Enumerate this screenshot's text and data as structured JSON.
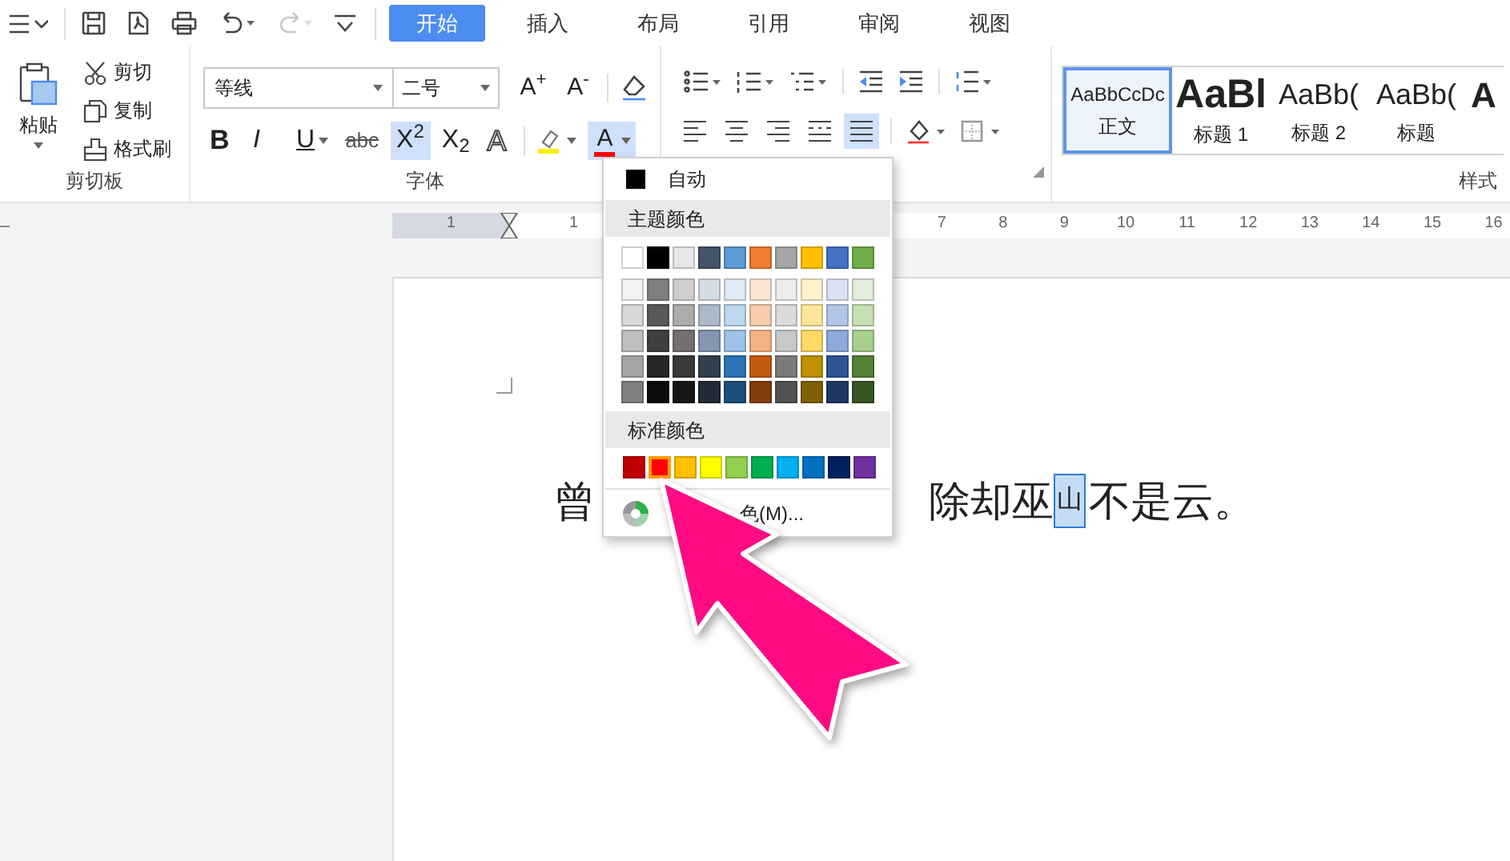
{
  "toolbar": {
    "redo": {
      "disabled": true
    },
    "tabs": [
      {
        "label": "开始",
        "selected": true
      },
      {
        "label": "插入",
        "selected": false
      },
      {
        "label": "布局",
        "selected": false
      },
      {
        "label": "引用",
        "selected": false
      },
      {
        "label": "审阅",
        "selected": false
      },
      {
        "label": "视图",
        "selected": false
      }
    ]
  },
  "ribbon": {
    "clipboard": {
      "paste": "粘贴",
      "items": [
        "剪切",
        "复制",
        "格式刷"
      ],
      "group_label": "剪切板"
    },
    "font": {
      "font_name": "等线",
      "font_size": "二号",
      "grow": "A$^{+}$",
      "shrink": "A$^{-}$",
      "format_buttons": [
        {
          "kind": "bold",
          "label": "B",
          "active": false
        },
        {
          "kind": "italic",
          "label": "I",
          "active": false
        },
        {
          "kind": "underline",
          "label": "U",
          "active": false
        },
        {
          "kind": "strike",
          "label": "abc",
          "active": false
        },
        {
          "kind": "superscript",
          "label": "X$^{2}$",
          "active": true
        },
        {
          "kind": "subscript",
          "label": "X$_{2}$",
          "active": false
        },
        {
          "kind": "outline",
          "label": "A",
          "active": false
        }
      ],
      "font_color": {
        "label": "A",
        "active": true
      },
      "group_label": "字体"
    },
    "paragraph": {
      "alignments": [
        {
          "selected": false
        },
        {
          "selected": false
        },
        {
          "selected": false
        },
        {
          "selected": false
        },
        {
          "selected": true
        }
      ]
    },
    "styles": {
      "items": [
        {
          "kind": "normal",
          "preview": "AaBbCcDc",
          "label": "正文",
          "selected": true
        },
        {
          "kind": "heading1",
          "preview": "AaBl",
          "label": "标题 1",
          "selected": false
        },
        {
          "kind": "heading2",
          "preview": "AaBb(",
          "label": "标题 2",
          "selected": false
        },
        {
          "kind": "heading2",
          "preview": "AaBb(",
          "label": "标题",
          "selected": false
        },
        {
          "kind": "partial",
          "preview": "A",
          "selected": false
        }
      ],
      "group_label": "样式"
    }
  },
  "ruler": {
    "labels": [
      "1",
      "1",
      "7",
      "8",
      "9",
      "10",
      "11",
      "12",
      "13",
      "14",
      "15",
      "16"
    ]
  },
  "document": {
    "first": "曾",
    "rest": [
      {
        "text": "除却巫",
        "selected": false
      },
      {
        "text": "山",
        "selected": true
      },
      {
        "text": "不是云。",
        "selected": false
      }
    ]
  },
  "color_menu": {
    "automatic": "自动",
    "theme_header": "主题颜色",
    "theme_colors": [
      [
        {
          "color": "#ffffff"
        },
        {
          "color": "#000000"
        },
        {
          "color": "#e7e6e6"
        },
        {
          "color": "#44546a"
        },
        {
          "color": "#5b9bd5"
        },
        {
          "color": "#ed7d31"
        },
        {
          "color": "#a5a5a5"
        },
        {
          "color": "#ffc000"
        },
        {
          "color": "#4472c4"
        },
        {
          "color": "#70ad47"
        }
      ],
      [
        {
          "color": "#f2f2f2"
        },
        {
          "color": "#7f7f7f"
        },
        {
          "color": "#d0cece"
        },
        {
          "color": "#d6dce4"
        },
        {
          "color": "#deebf6"
        },
        {
          "color": "#fbe5d5"
        },
        {
          "color": "#ededed"
        },
        {
          "color": "#fff2cc"
        },
        {
          "color": "#dae3f3"
        },
        {
          "color": "#e2efd9"
        }
      ],
      [
        {
          "color": "#d8d8d8"
        },
        {
          "color": "#595959"
        },
        {
          "color": "#aeabab"
        },
        {
          "color": "#adb9ca"
        },
        {
          "color": "#bdd7ee"
        },
        {
          "color": "#f7cbac"
        },
        {
          "color": "#dbdbdb"
        },
        {
          "color": "#fee599"
        },
        {
          "color": "#b4c6e7"
        },
        {
          "color": "#c5e0b3"
        }
      ],
      [
        {
          "color": "#bfbfbf"
        },
        {
          "color": "#3f3f3f"
        },
        {
          "color": "#757070"
        },
        {
          "color": "#8496b0"
        },
        {
          "color": "#9dc3e6"
        },
        {
          "color": "#f4b183"
        },
        {
          "color": "#c9c9c9"
        },
        {
          "color": "#ffd965"
        },
        {
          "color": "#8eaadb"
        },
        {
          "color": "#a8d08d"
        }
      ],
      [
        {
          "color": "#a5a5a5"
        },
        {
          "color": "#262626"
        },
        {
          "color": "#3a3838"
        },
        {
          "color": "#323f4f"
        },
        {
          "color": "#2e75b5"
        },
        {
          "color": "#c55a11"
        },
        {
          "color": "#7b7b7b"
        },
        {
          "color": "#bf9000"
        },
        {
          "color": "#2f5496"
        },
        {
          "color": "#538135"
        }
      ],
      [
        {
          "color": "#7f7f7f"
        },
        {
          "color": "#0c0c0c"
        },
        {
          "color": "#171616"
        },
        {
          "color": "#222a35"
        },
        {
          "color": "#1e4e79"
        },
        {
          "color": "#843c0b"
        },
        {
          "color": "#525252"
        },
        {
          "color": "#7f6000"
        },
        {
          "color": "#1f3864"
        },
        {
          "color": "#375623"
        }
      ]
    ],
    "standard_header": "标准颜色",
    "standard_colors": [
      {
        "color": "#c00000",
        "selected": false
      },
      {
        "color": "#ff0000",
        "selected": true
      },
      {
        "color": "#ffc000",
        "selected": false
      },
      {
        "color": "#ffff00",
        "selected": false
      },
      {
        "color": "#92d050",
        "selected": false
      },
      {
        "color": "#00b050",
        "selected": false
      },
      {
        "color": "#00b0f0",
        "selected": false
      },
      {
        "color": "#0070c0",
        "selected": false
      },
      {
        "color": "#002060",
        "selected": false
      },
      {
        "color": "#7030a0",
        "selected": false
      }
    ],
    "more": "色(M)..."
  }
}
